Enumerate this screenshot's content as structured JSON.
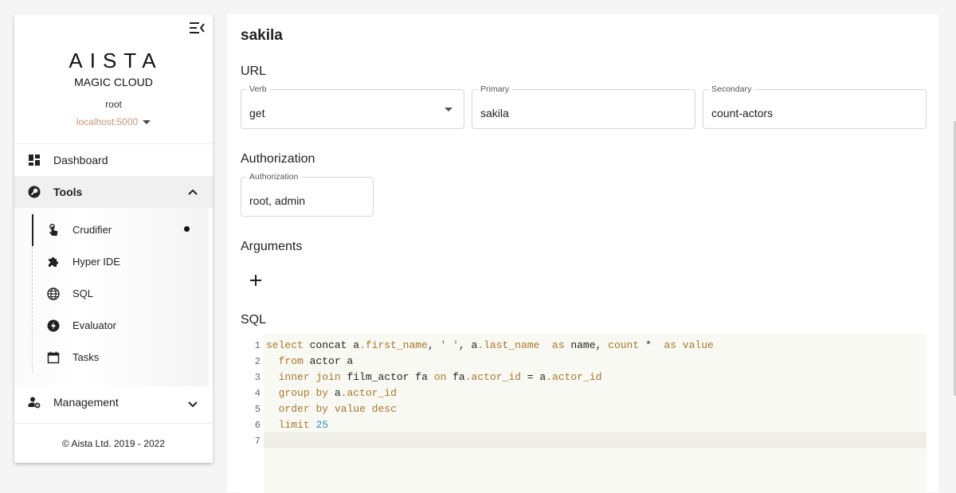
{
  "sidebar": {
    "logo_text": "AISTA",
    "logo_subtitle": "MAGIC CLOUD",
    "username": "root",
    "backend": "localhost:5000",
    "nav": {
      "dashboard": "Dashboard",
      "tools": "Tools",
      "management": "Management"
    },
    "tools_submenu": [
      {
        "label": "Crudifier",
        "active": true
      },
      {
        "label": "Hyper IDE"
      },
      {
        "label": "SQL"
      },
      {
        "label": "Evaluator"
      },
      {
        "label": "Tasks"
      }
    ],
    "footer": "© Aista Ltd. 2019 - 2022"
  },
  "main": {
    "title": "sakila",
    "url_section": "URL",
    "verb": {
      "label": "Verb",
      "value": "get"
    },
    "primary": {
      "label": "Primary",
      "value": "sakila"
    },
    "secondary": {
      "label": "Secondary",
      "value": "count-actors"
    },
    "authorization_section": "Authorization",
    "authorization": {
      "label": "Authorization",
      "value": "root, admin"
    },
    "arguments_section": "Arguments",
    "sql_section": "SQL",
    "sql_lines": [
      "select concat a.first_name, ' ', a.last_name  as name, count *  as value",
      "  from actor a",
      "  inner join film_actor fa on fa.actor_id = a.actor_id",
      "  group by a.actor_id",
      "  order by value desc",
      "  limit 25",
      ""
    ],
    "line_numbers": [
      "1",
      "2",
      "3",
      "4",
      "5",
      "6",
      "7"
    ]
  },
  "colors": {
    "accent_backend": "#c8977a",
    "sql_keyword": "#a8762b",
    "sql_number": "#2a8fc6",
    "editor_bg": "#f9f9f3"
  }
}
